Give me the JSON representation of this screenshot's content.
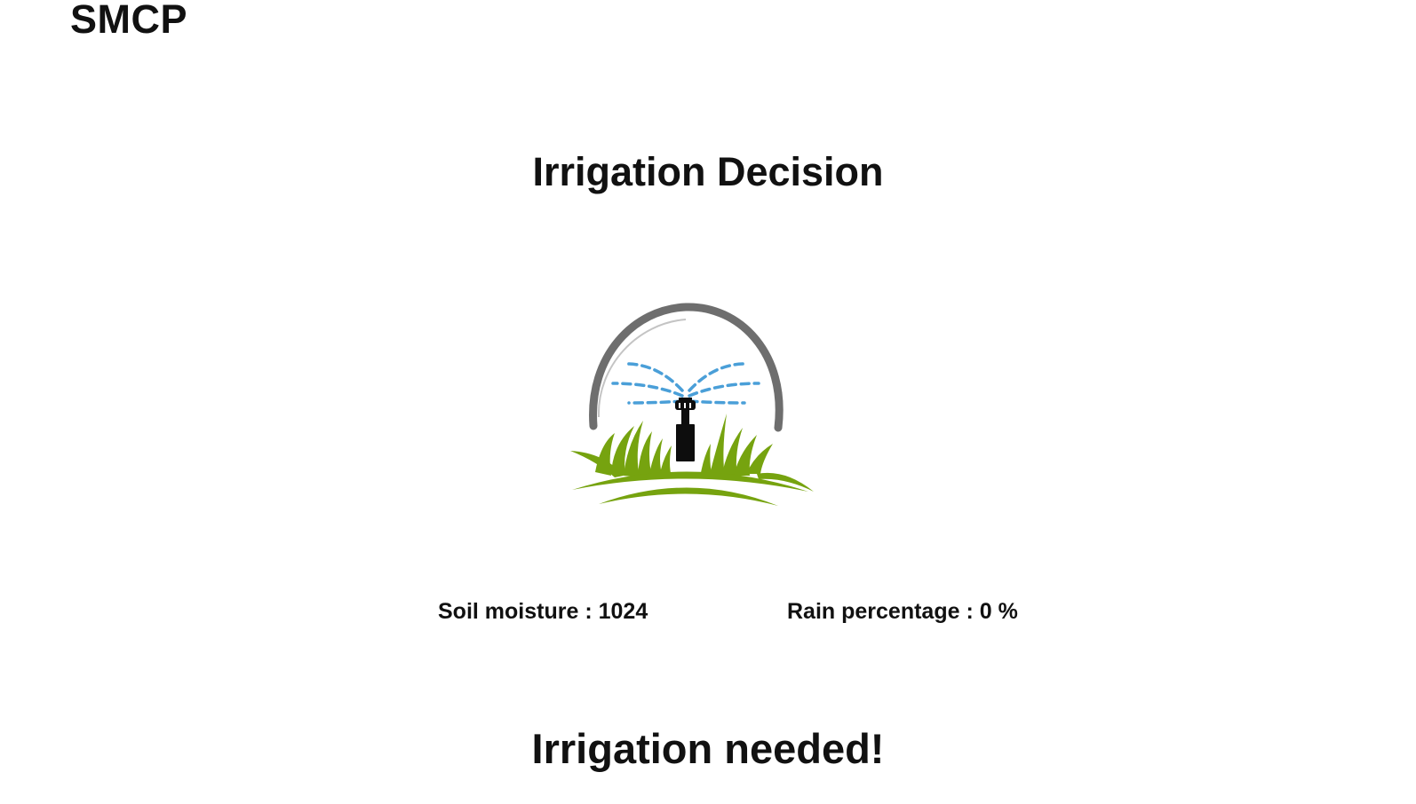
{
  "header": {
    "brand": "SMCP"
  },
  "main": {
    "title": "Irrigation Decision",
    "logo_icon": "lawn-sprinkler-icon",
    "readings": {
      "soil_label": "Soil moisture",
      "soil_value": "1024",
      "rain_label": "Rain percentage",
      "rain_value": "0",
      "rain_unit": "%"
    },
    "decision": "Irrigation needed!"
  },
  "colors": {
    "text": "#111111",
    "arc": "#6e6e6e",
    "water": "#4a9fd8",
    "grass": "#76a30f",
    "sprinkler": "#0d0d0d",
    "background": "#ffffff"
  }
}
